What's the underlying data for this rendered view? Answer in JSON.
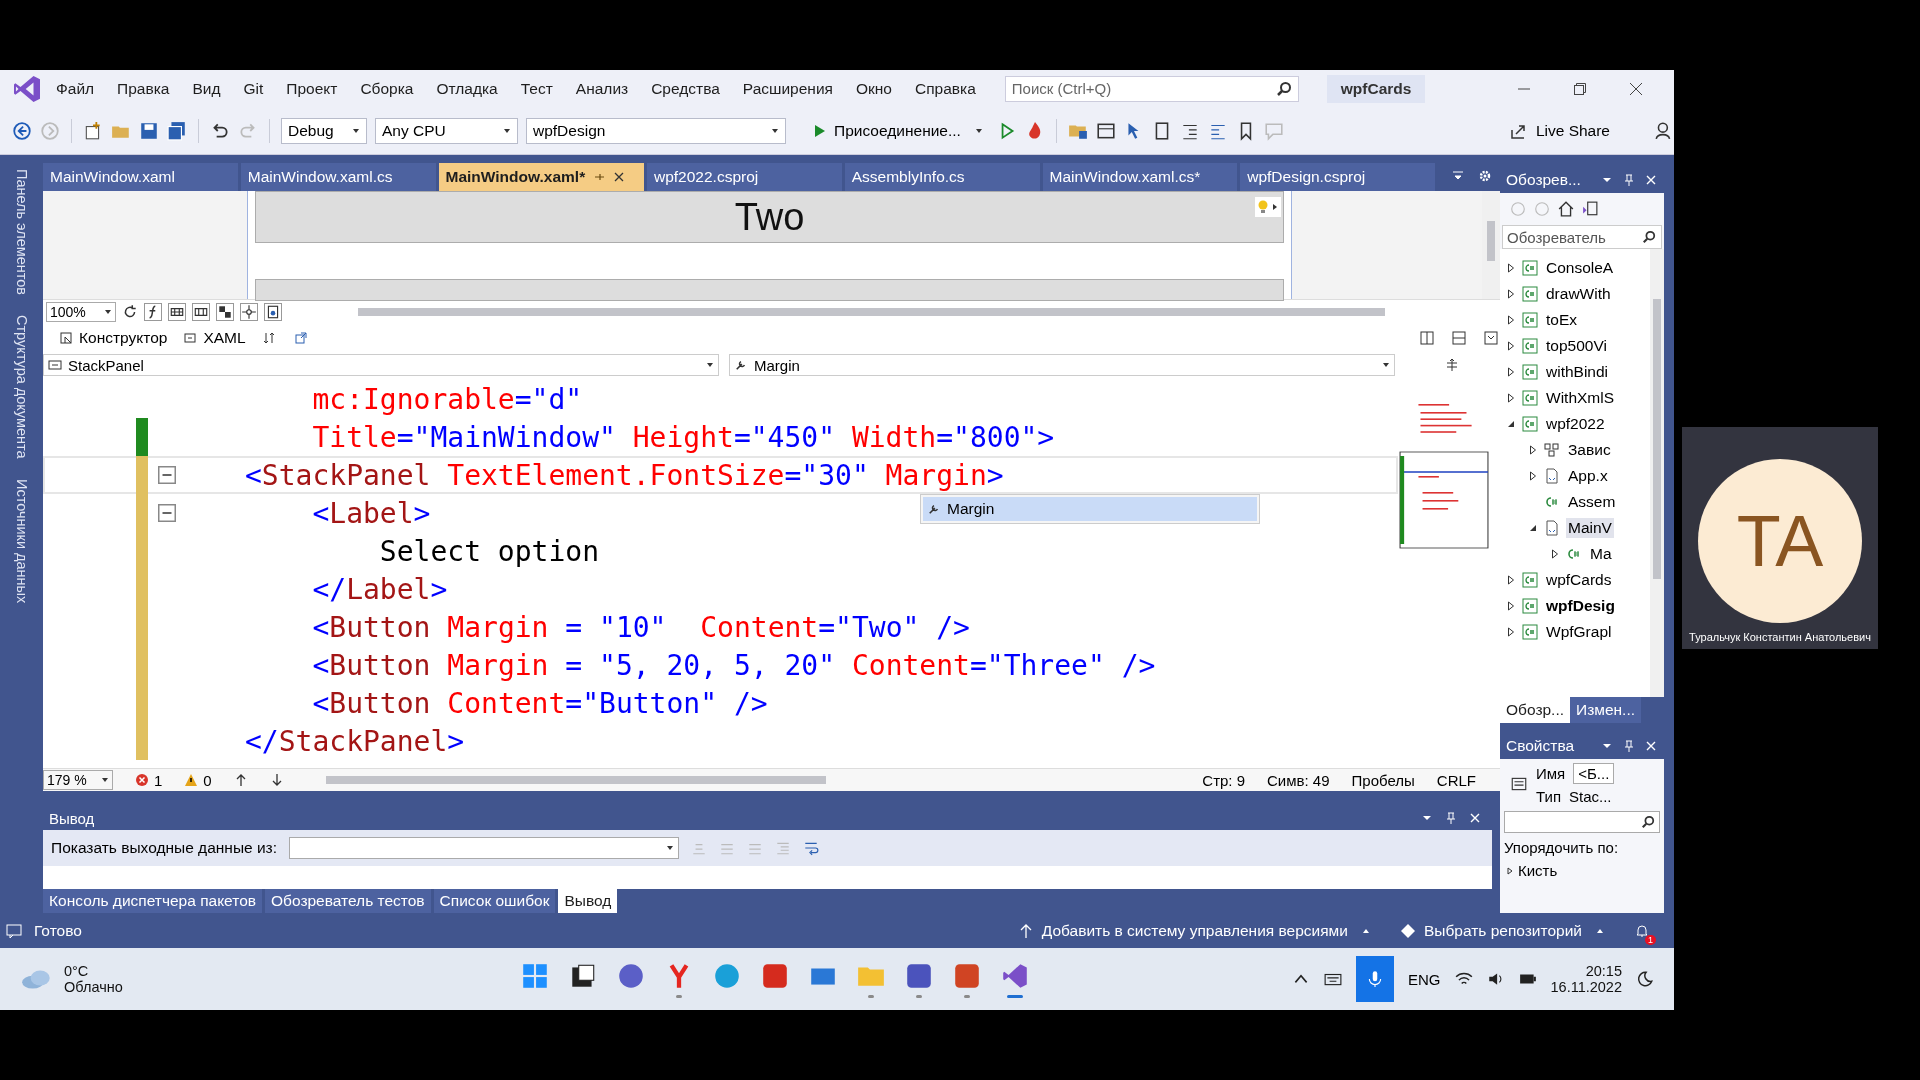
{
  "menu": {
    "items": [
      "Файл",
      "Правка",
      "Вид",
      "Git",
      "Проект",
      "Сборка",
      "Отладка",
      "Тест",
      "Анализ",
      "Средства",
      "Расширения",
      "Окно",
      "Справка"
    ],
    "search_placeholder": "Поиск (Ctrl+Q)",
    "solution_name": "wpfCards"
  },
  "toolbar": {
    "configuration": "Debug",
    "platform": "Any CPU",
    "startup_project": "wpfDesign",
    "attach": "Присоединение...",
    "live_share": "Live Share"
  },
  "tabs": [
    {
      "label": "MainWindow.xaml",
      "selected": false
    },
    {
      "label": "MainWindow.xaml.cs",
      "selected": false
    },
    {
      "label": "MainWindow.xaml*",
      "selected": true
    },
    {
      "label": "wpf2022.csproj",
      "selected": false
    },
    {
      "label": "AssemblyInfo.cs",
      "selected": false
    },
    {
      "label": "MainWindow.xaml.cs*",
      "selected": false
    },
    {
      "label": "wpfDesign.csproj",
      "selected": false
    }
  ],
  "left_strip": [
    "Панель элементов",
    "Структура документа",
    "Источники данных"
  ],
  "designer": {
    "button_text": "Two",
    "zoom": "100%"
  },
  "view_tabs": [
    {
      "label": "Конструктор",
      "kind": "design"
    },
    {
      "label": "XAML",
      "kind": "xaml"
    }
  ],
  "element_dropdown": "StackPanel",
  "member_dropdown": "Margin",
  "code": [
    {
      "modified": false,
      "fold": false,
      "current": false,
      "tokens": [
        {
          "kind": "attr",
          "text": "    mc:Ignorable"
        },
        {
          "kind": "tag",
          "text": "="
        },
        {
          "kind": "val",
          "text": "\"d\""
        }
      ]
    },
    {
      "modified": true,
      "saved": true,
      "fold": false,
      "current": false,
      "tokens": [
        {
          "kind": "attr",
          "text": "    Title"
        },
        {
          "kind": "tag",
          "text": "="
        },
        {
          "kind": "val",
          "text": "\"MainWindow\" "
        },
        {
          "kind": "attr",
          "text": "Height"
        },
        {
          "kind": "tag",
          "text": "="
        },
        {
          "kind": "val",
          "text": "\"450\" "
        },
        {
          "kind": "attr",
          "text": "Width"
        },
        {
          "kind": "tag",
          "text": "="
        },
        {
          "kind": "val",
          "text": "\"800\">"
        }
      ]
    },
    {
      "modified": true,
      "saved": false,
      "fold": true,
      "current": true,
      "tokens": [
        {
          "kind": "tag",
          "text": "<"
        },
        {
          "kind": "el",
          "text": "StackPanel "
        },
        {
          "kind": "attr",
          "text": "TextElement.FontSize"
        },
        {
          "kind": "tag",
          "text": "="
        },
        {
          "kind": "val",
          "text": "\"30\" "
        },
        {
          "kind": "attr",
          "text": "Margin"
        },
        {
          "kind": "tag",
          "text": ">"
        }
      ]
    },
    {
      "modified": true,
      "saved": false,
      "fold": true,
      "current": false,
      "tokens": [
        {
          "kind": "tag",
          "text": "    <"
        },
        {
          "kind": "el",
          "text": "Label"
        },
        {
          "kind": "tag",
          "text": ">"
        }
      ]
    },
    {
      "modified": true,
      "saved": false,
      "fold": false,
      "current": false,
      "tokens": [
        {
          "kind": "text",
          "text": "        Select option"
        }
      ]
    },
    {
      "modified": true,
      "saved": false,
      "fold": false,
      "current": false,
      "tokens": [
        {
          "kind": "tag",
          "text": "    </"
        },
        {
          "kind": "el",
          "text": "Label"
        },
        {
          "kind": "tag",
          "text": ">"
        }
      ]
    },
    {
      "modified": true,
      "saved": false,
      "fold": false,
      "current": false,
      "tokens": [
        {
          "kind": "tag",
          "text": "    <"
        },
        {
          "kind": "el",
          "text": "Button "
        },
        {
          "kind": "attr",
          "text": "Margin"
        },
        {
          "kind": "tag",
          "text": " = "
        },
        {
          "kind": "val",
          "text": "\"10\"  "
        },
        {
          "kind": "attr",
          "text": "Content"
        },
        {
          "kind": "tag",
          "text": "="
        },
        {
          "kind": "val",
          "text": "\"Two\" />"
        }
      ]
    },
    {
      "modified": true,
      "saved": false,
      "fold": false,
      "current": false,
      "tokens": [
        {
          "kind": "tag",
          "text": "    <"
        },
        {
          "kind": "el",
          "text": "Button "
        },
        {
          "kind": "attr",
          "text": "Margin"
        },
        {
          "kind": "tag",
          "text": " = "
        },
        {
          "kind": "val",
          "text": "\"5, 20, 5, 20\" "
        },
        {
          "kind": "attr",
          "text": "Content"
        },
        {
          "kind": "tag",
          "text": "="
        },
        {
          "kind": "val",
          "text": "\"Three\" />"
        }
      ]
    },
    {
      "modified": true,
      "saved": false,
      "fold": false,
      "current": false,
      "tokens": [
        {
          "kind": "tag",
          "text": "    <"
        },
        {
          "kind": "el",
          "text": "Button "
        },
        {
          "kind": "attr",
          "text": "Content"
        },
        {
          "kind": "tag",
          "text": "="
        },
        {
          "kind": "val",
          "text": "\"Button\" />"
        }
      ]
    },
    {
      "modified": true,
      "saved": false,
      "fold": false,
      "current": false,
      "tokens": [
        {
          "kind": "tag",
          "text": "</"
        },
        {
          "kind": "el",
          "text": "StackPanel"
        },
        {
          "kind": "tag",
          "text": ">"
        }
      ]
    }
  ],
  "autocomplete": [
    {
      "label": "Margin",
      "selected": true
    }
  ],
  "editor_status": {
    "zoom": "179 %",
    "errors": "1",
    "warnings": "0",
    "line": "Стр: 9",
    "col": "Симв: 49",
    "whitespace": "Пробелы",
    "eol": "CRLF"
  },
  "solution_explorer": {
    "title": "Обозрев...",
    "search_placeholder": "Обозреватель",
    "tree": [
      {
        "label": "ConsoleA",
        "kind": "project",
        "expanded": false
      },
      {
        "label": "drawWith",
        "kind": "project",
        "expanded": false
      },
      {
        "label": "toEx",
        "kind": "project",
        "expanded": false
      },
      {
        "label": "top500Vi",
        "kind": "project",
        "expanded": false
      },
      {
        "label": "withBindi",
        "kind": "project",
        "expanded": false
      },
      {
        "label": "WithXmlS",
        "kind": "project",
        "expanded": false
      },
      {
        "label": "wpf2022",
        "kind": "project",
        "expanded": true,
        "children": [
          {
            "label": "Завис",
            "kind": "deps",
            "expanded": false
          },
          {
            "label": "App.x",
            "kind": "xaml",
            "expanded": false
          },
          {
            "label": "Assem",
            "kind": "cs"
          },
          {
            "label": "MainV",
            "kind": "xaml",
            "expanded": true,
            "selected": true,
            "children": [
              {
                "label": "Ma",
                "kind": "cs",
                "expanded": false
              }
            ]
          }
        ]
      },
      {
        "label": "wpfCards",
        "kind": "project",
        "expanded": false
      },
      {
        "label": "wpfDesig",
        "kind": "project",
        "expanded": false,
        "startup": true
      },
      {
        "label": "WpfGrapl",
        "kind": "project",
        "expanded": false
      }
    ],
    "tabs": [
      {
        "label": "Обозр...",
        "selected": true
      },
      {
        "label": "Измен...",
        "selected": false
      }
    ]
  },
  "properties": {
    "title": "Свойства",
    "name_label": "Имя",
    "name_value": "<Б...",
    "type_label": "Тип",
    "type_value": "Stac...",
    "sort_label": "Упорядочить по:",
    "category": "Кисть"
  },
  "output": {
    "title": "Вывод",
    "show_label": "Показать выходные данные из:"
  },
  "bottom_tabs": [
    {
      "label": "Консоль диспетчера пакетов",
      "selected": false
    },
    {
      "label": "Обозреватель тестов",
      "selected": false
    },
    {
      "label": "Список ошибок",
      "selected": false
    },
    {
      "label": "Вывод",
      "selected": true
    }
  ],
  "status_bar": {
    "ready": "Готово",
    "vcs": "Добавить в систему управления версиями",
    "repo": "Выбрать репозиторий",
    "notifications": "1"
  },
  "taskbar": {
    "weather_temp": "0°C",
    "weather_text": "Облачно",
    "language": "ENG",
    "time": "20:15",
    "date": "16.11.2022",
    "apps": [
      {
        "kind": "start",
        "running": false
      },
      {
        "kind": "taskview",
        "running": false
      },
      {
        "kind": "meet",
        "running": false
      },
      {
        "kind": "yandex",
        "running": true
      },
      {
        "kind": "edge",
        "running": false
      },
      {
        "kind": "acrobat",
        "running": false
      },
      {
        "kind": "mail",
        "running": false
      },
      {
        "kind": "explorer",
        "running": true
      },
      {
        "kind": "teams",
        "running": true
      },
      {
        "kind": "powerpoint",
        "running": true
      },
      {
        "kind": "vs",
        "running": true,
        "active": true
      }
    ]
  },
  "participant": {
    "initials": "TA",
    "name": "Туральчук Константин Анатольевич"
  }
}
